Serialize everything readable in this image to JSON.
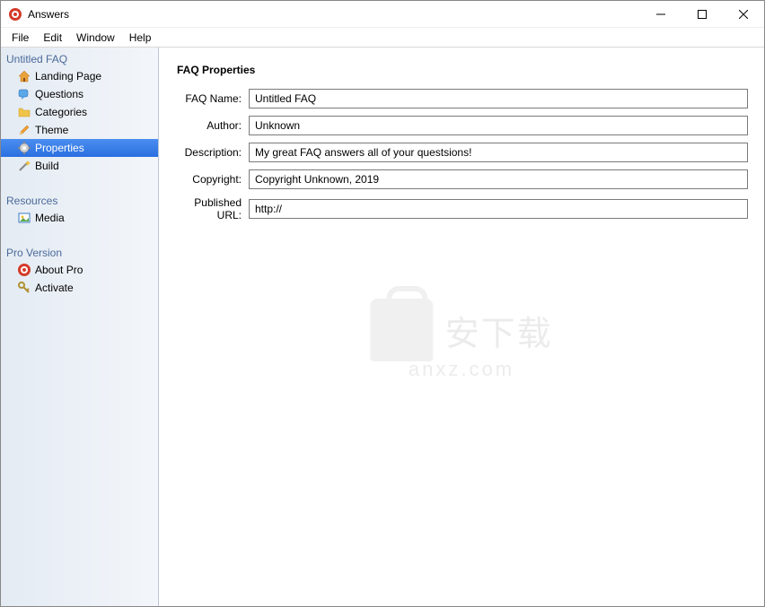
{
  "window": {
    "title": "Answers"
  },
  "menu": {
    "file": "File",
    "edit": "Edit",
    "window": "Window",
    "help": "Help"
  },
  "sidebar": {
    "section_faq": "Untitled FAQ",
    "items": {
      "landing": "Landing Page",
      "questions": "Questions",
      "categories": "Categories",
      "theme": "Theme",
      "properties": "Properties",
      "build": "Build"
    },
    "section_resources": "Resources",
    "resources": {
      "media": "Media"
    },
    "section_pro": "Pro Version",
    "pro": {
      "about": "About Pro",
      "activate": "Activate"
    }
  },
  "main": {
    "heading": "FAQ Properties",
    "labels": {
      "faq_name": "FAQ Name:",
      "author": "Author:",
      "description": "Description:",
      "copyright": "Copyright:",
      "published_url": "Published URL:"
    },
    "values": {
      "faq_name": "Untitled FAQ",
      "author": "Unknown",
      "description": "My great FAQ answers all of your questsions!",
      "copyright": "Copyright Unknown, 2019",
      "published_url": "http://"
    }
  },
  "watermark": {
    "text": "安下载",
    "sub": "anxz.com"
  }
}
